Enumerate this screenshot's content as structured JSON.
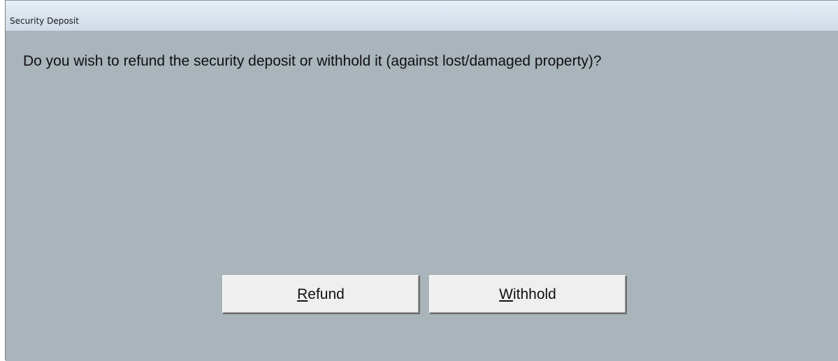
{
  "window": {
    "title": "Security Deposit"
  },
  "dialog": {
    "message": "Do you wish to refund the security deposit or withhold it (against lost/damaged property)?"
  },
  "buttons": {
    "refund": {
      "mnemonic": "R",
      "rest": "efund"
    },
    "withhold": {
      "mnemonic": "W",
      "rest": "ithhold"
    }
  },
  "colors": {
    "client_background": "#a9b4bb",
    "button_face": "#efefef",
    "titlebar": "#dbe5ef"
  }
}
